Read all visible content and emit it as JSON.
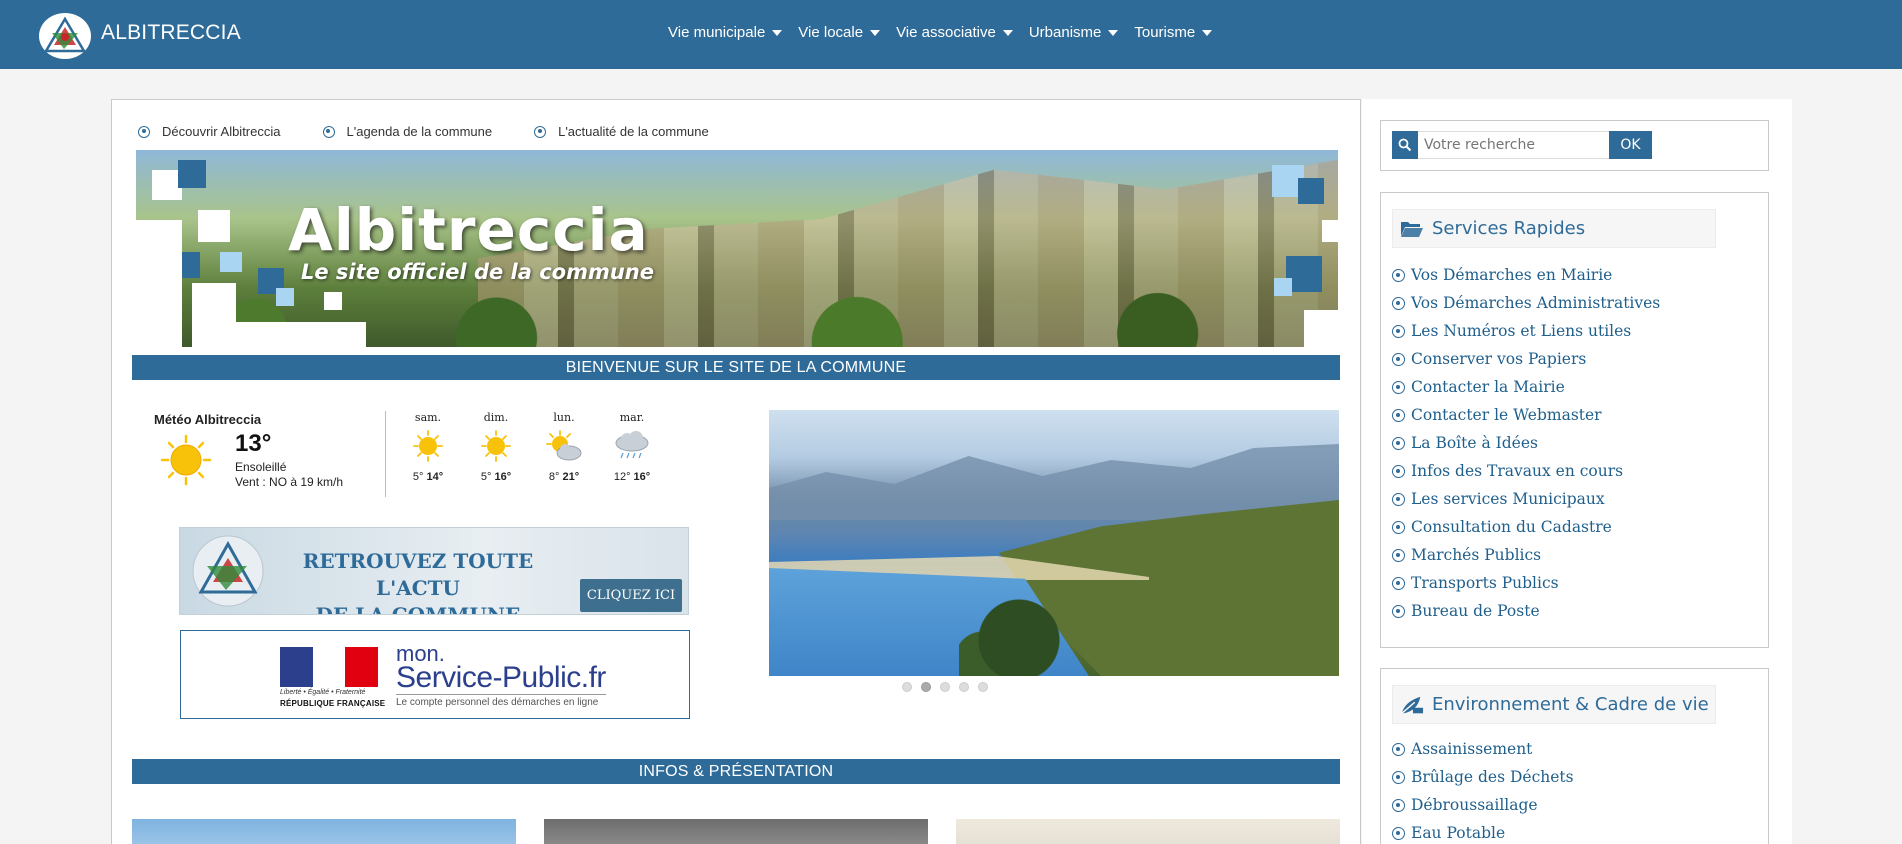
{
  "header": {
    "site_name": "ALBITRECCIA",
    "nav": [
      {
        "label": "Vie municipale"
      },
      {
        "label": "Vie locale"
      },
      {
        "label": "Vie associative"
      },
      {
        "label": "Urbanisme"
      },
      {
        "label": "Tourisme"
      }
    ]
  },
  "quicklinks": [
    {
      "label": "Découvrir Albitreccia"
    },
    {
      "label": "L'agenda de la commune"
    },
    {
      "label": "L'actualité de la commune"
    }
  ],
  "banner": {
    "title": "Albitreccia",
    "subtitle": "Le site officiel de la commune"
  },
  "welcome_bar": "BIENVENUE SUR LE SITE DE LA COMMUNE",
  "weather": {
    "title": "Météo Albitreccia",
    "temp": "13°",
    "condition": "Ensoleillé",
    "wind": "Vent : NO à 19 km/h",
    "days": [
      {
        "name": "sam.",
        "min": "5°",
        "max": "14°",
        "icon": "sun-icon"
      },
      {
        "name": "dim.",
        "min": "5°",
        "max": "16°",
        "icon": "sun-icon"
      },
      {
        "name": "lun.",
        "min": "8°",
        "max": "21°",
        "icon": "sun-cloud-icon"
      },
      {
        "name": "mar.",
        "min": "12°",
        "max": "16°",
        "icon": "rain-cloud-icon"
      }
    ]
  },
  "promo_actu": {
    "line1": "RETROUVEZ TOUTE L'ACTU",
    "line2": "DE LA COMMUNE",
    "button": "CLIQUEZ ICI"
  },
  "promo_service_public": {
    "motto": "Liberté • Égalité • Fraternité",
    "republique": "RÉPUBLIQUE FRANÇAISE",
    "mon": "mon.",
    "main": "Service-Public.fr",
    "sub": "Le compte personnel des démarches en ligne"
  },
  "slider": {
    "count": 5,
    "active_index": 1
  },
  "infos_bar": "INFOS & PRÉSENTATION",
  "search": {
    "placeholder": "Votre recherche",
    "button": "OK"
  },
  "services_rapides": {
    "title": "Services Rapides",
    "items": [
      "Vos Démarches en Mairie",
      "Vos Démarches Administratives",
      "Les Numéros et Liens utiles",
      "Conserver vos Papiers",
      "Contacter la Mairie",
      "Contacter le Webmaster",
      "La Boîte à Idées",
      "Infos des Travaux en cours",
      "Les services Municipaux",
      "Consultation du Cadastre",
      "Marchés Publics",
      "Transports Publics",
      "Bureau de Poste"
    ]
  },
  "environnement": {
    "title": "Environnement & Cadre de vie",
    "items": [
      "Assainissement",
      "Brûlage des Déchets",
      "Débroussaillage",
      "Eau Potable"
    ]
  },
  "colors": {
    "primary": "#2f6b98",
    "link": "#1f5f8c",
    "sun": "#f9c20a"
  }
}
